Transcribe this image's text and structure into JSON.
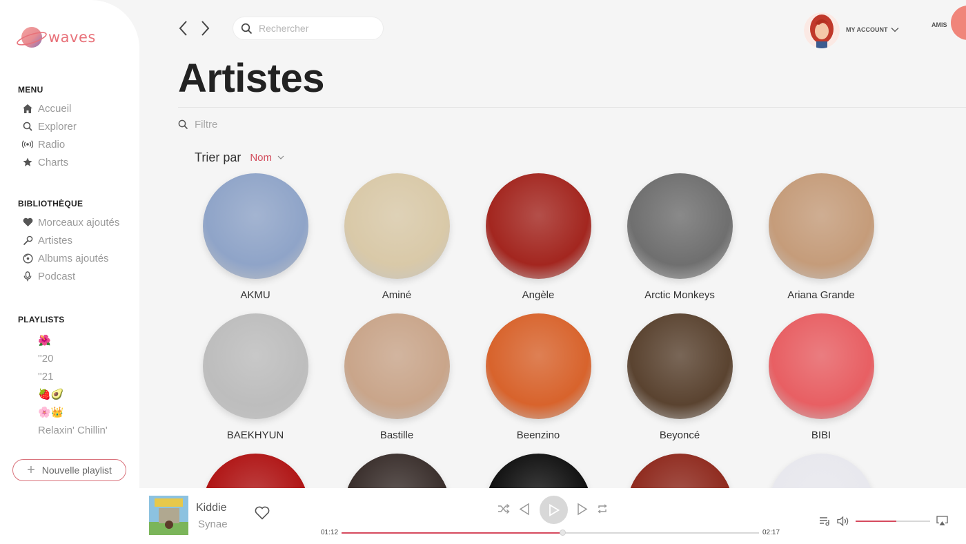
{
  "app": {
    "name": "waves"
  },
  "nav": {
    "back_icon": "chevron-left-icon",
    "forward_icon": "chevron-right-icon"
  },
  "search": {
    "placeholder": "Rechercher"
  },
  "account": {
    "label": "MY ACCOUNT",
    "friends_label": "AMIS"
  },
  "sidebar": {
    "menu_title": "MENU",
    "menu_items": [
      {
        "label": "Accueil",
        "icon": "home-icon"
      },
      {
        "label": "Explorer",
        "icon": "search-icon"
      },
      {
        "label": "Radio",
        "icon": "radio-icon"
      },
      {
        "label": "Charts",
        "icon": "star-icon"
      }
    ],
    "library_title": "BIBLIOTHÈQUE",
    "library_items": [
      {
        "label": "Morceaux ajoutés",
        "icon": "heart-icon"
      },
      {
        "label": "Artistes",
        "icon": "microphone-icon"
      },
      {
        "label": "Albums ajoutés",
        "icon": "disc-icon"
      },
      {
        "label": "Podcast",
        "icon": "podcast-mic-icon"
      }
    ],
    "playlists_title": "PLAYLISTS",
    "playlists": [
      {
        "label": "🌺"
      },
      {
        "label": "''20"
      },
      {
        "label": "''21"
      },
      {
        "label": "🍓🥑"
      },
      {
        "label": "🌸👑"
      },
      {
        "label": "Relaxin' Chillin'"
      }
    ],
    "new_playlist": "Nouvelle playlist"
  },
  "main": {
    "title": "Artistes",
    "filter_placeholder": "Filtre",
    "sort_label": "Trier par",
    "sort_value": "Nom"
  },
  "artists": [
    {
      "name": "AKMU",
      "color": "#8fa4c8"
    },
    {
      "name": "Aminé",
      "color": "#d9c9a8"
    },
    {
      "name": "Angèle",
      "color": "#a3261f"
    },
    {
      "name": "Arctic Monkeys",
      "color": "#6f6f6f"
    },
    {
      "name": "Ariana Grande",
      "color": "#c59c7a"
    },
    {
      "name": "BAEKHYUN",
      "color": "#bdbdbd"
    },
    {
      "name": "Bastille",
      "color": "#c9a58a"
    },
    {
      "name": "Beenzino",
      "color": "#d8632c"
    },
    {
      "name": "Beyoncé",
      "color": "#5a4330"
    },
    {
      "name": "BIBI",
      "color": "#e85f63"
    },
    {
      "name": "",
      "color": "#b01515"
    },
    {
      "name": "",
      "color": "#3a2f2c"
    },
    {
      "name": "",
      "color": "#111111"
    },
    {
      "name": "",
      "color": "#8f2a1e"
    },
    {
      "name": "",
      "color": "#e8e8ee"
    }
  ],
  "player": {
    "song": "Kiddie",
    "artist": "Synae",
    "current_time": "01:12",
    "total_time": "02:17",
    "progress": 0.53,
    "volume": 0.55
  },
  "colors": {
    "accent": "#d64a5e",
    "logo": "#e8727a"
  }
}
